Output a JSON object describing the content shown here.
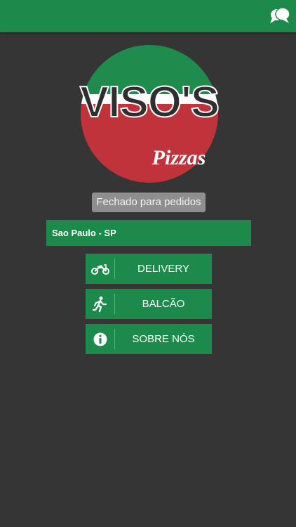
{
  "header": {
    "chat_icon": "chat-bubbles-icon",
    "background": "#1c8a4a"
  },
  "logo": {
    "brand_text": "VISO'S",
    "sub_text": "Pizzas",
    "colors": {
      "green": "#1f8b4c",
      "white": "#ffffff",
      "red": "#c0333a",
      "text": "#2f2f2f"
    }
  },
  "status": {
    "label": "Fechado para pedidos"
  },
  "location": {
    "label": "Sao Paulo - SP"
  },
  "menu": {
    "delivery": {
      "label": "DELIVERY",
      "icon": "motorcycle-icon"
    },
    "balcao": {
      "label": "BALCÃO",
      "icon": "walking-person-icon"
    },
    "sobre": {
      "label": "SOBRE NÓS",
      "icon": "info-icon"
    }
  },
  "colors": {
    "accent": "#1c8a4a",
    "background": "#353535",
    "status_pill": "#8f8f8f"
  }
}
